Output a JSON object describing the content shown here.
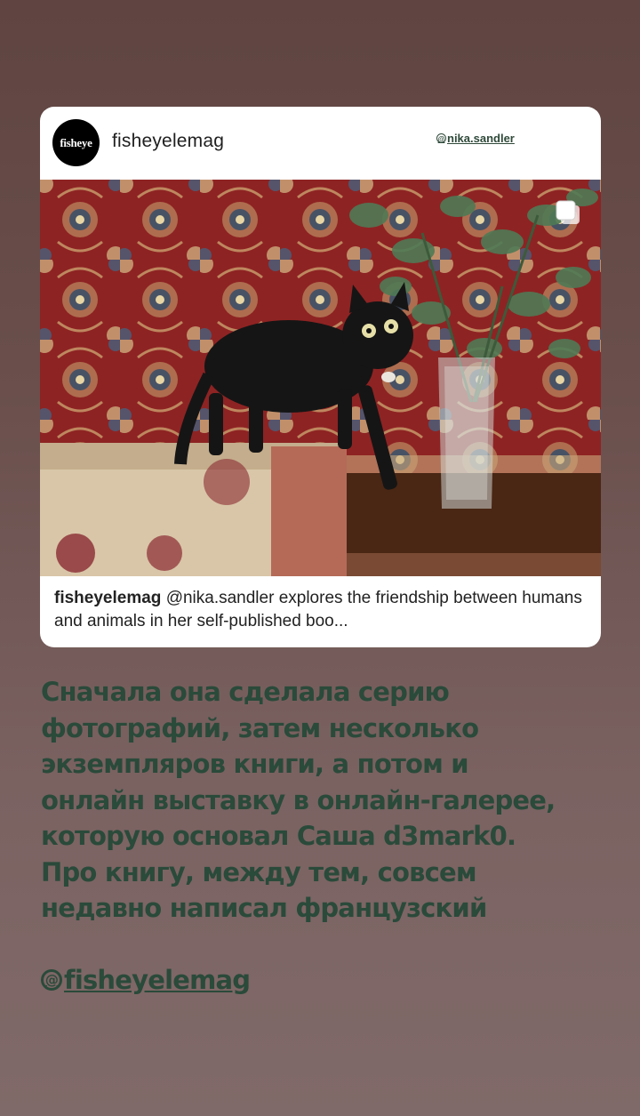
{
  "post": {
    "avatar_text": "fisheye",
    "username": "fisheyelemag",
    "mention_sticker": "nika.sandler",
    "caption_user": "fisheyelemag",
    "caption_text": "@nika.sandler explores the friendship between humans and animals in her self-published boo..."
  },
  "story": {
    "text": "Сначала она сделала серию фотографий, затем несколько экземпляров книги, а потом и онлайн выставку в онлайн-галерее, которую основал Саша d3mark0. Про книгу, между тем, совсем недавно написал французский",
    "mention": "fisheyelemag"
  },
  "icons": {
    "mention_badge": "at-sign-icon",
    "multi_photo": "multiple-photos-icon"
  },
  "colors": {
    "story_text": "#2a4a3a",
    "card_bg": "#ffffff"
  }
}
